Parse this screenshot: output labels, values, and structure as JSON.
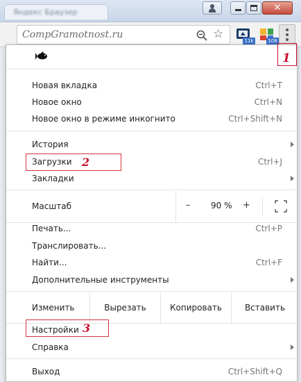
{
  "window": {
    "tab_title": "Яндекс Браузер",
    "close_glyph": "✕"
  },
  "toolbar": {
    "site_label": "CompGramotnost.ru",
    "star_glyph": "☆",
    "extensions": [
      {
        "badge": "11k"
      },
      {
        "badge": "108"
      }
    ]
  },
  "menu": {
    "group1": [
      {
        "label": "Новая вкладка",
        "shortcut": "Ctrl+T"
      },
      {
        "label": "Новое окно",
        "shortcut": "Ctrl+N"
      },
      {
        "label": "Новое окно в режиме инкогнито",
        "shortcut": "Ctrl+Shift+N"
      }
    ],
    "group2": [
      {
        "label": "История",
        "shortcut": ""
      },
      {
        "label": "Загрузки",
        "shortcut": "Ctrl+J"
      },
      {
        "label": "Закладки",
        "shortcut": ""
      }
    ],
    "zoom": {
      "label": "Масштаб",
      "minus": "–",
      "value": "90 %",
      "plus": "+"
    },
    "group3": [
      {
        "label": "Печать...",
        "shortcut": "Ctrl+P"
      },
      {
        "label": "Транслировать...",
        "shortcut": ""
      },
      {
        "label": "Найти...",
        "shortcut": "Ctrl+F"
      },
      {
        "label": "Дополнительные инструменты",
        "shortcut": ""
      }
    ],
    "edit": {
      "label": "Изменить",
      "cut": "Вырезать",
      "copy": "Копировать",
      "paste": "Вставить"
    },
    "group4": [
      {
        "label": "Настройки",
        "shortcut": ""
      },
      {
        "label": "Справка",
        "shortcut": ""
      }
    ],
    "exit": {
      "label": "Выход",
      "shortcut": "Ctrl+Shift+Q"
    }
  },
  "annotations": {
    "menu_button": "1",
    "downloads": "2",
    "settings": "3",
    "color": "#c8102e"
  }
}
